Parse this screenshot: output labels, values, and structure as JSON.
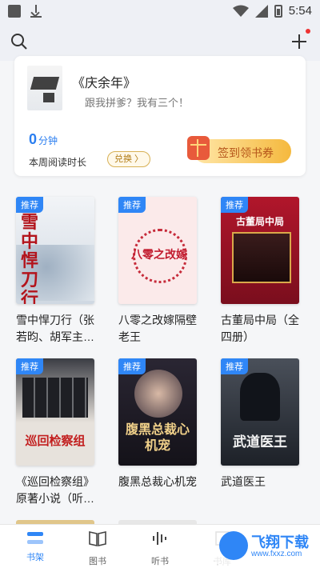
{
  "status": {
    "time": "5:54"
  },
  "header": {
    "search_icon": "search-icon",
    "add_icon": "plus-icon"
  },
  "current_book": {
    "title": "《庆余年》",
    "subtitle": "跟我拼爹？我有三个！",
    "minutes": "0",
    "minutes_unit": "分钟",
    "week_label": "本周阅读时长",
    "exchange_label": "兑换 〉",
    "signin_label": "签到领书券"
  },
  "badge_label": "推荐",
  "books": [
    {
      "title": "雪中悍刀行（张若昀、胡军主…",
      "cover_text": "雪中悍刀行",
      "cover_bg": "#e9edf2"
    },
    {
      "title": "八零之改嫁隔壁老王",
      "cover_text": "八零之改嫁",
      "cover_bg": "#fbe8e8"
    },
    {
      "title": "古董局中局（全四册）",
      "cover_text": "古董局中局",
      "cover_bg": "#a8182a"
    },
    {
      "title": "《巡回检察组》原著小说（听…",
      "cover_text": "巡回检察组",
      "cover_bg": "#e7e2dc"
    },
    {
      "title": "腹黑总裁心机宠",
      "cover_text": "腹黑总裁心机宠",
      "cover_bg": "#1f1d2b"
    },
    {
      "title": "武道医王",
      "cover_text": "武道医王",
      "cover_bg": "#2a2f38"
    }
  ],
  "tabs": [
    {
      "label": "书架",
      "icon": "bookshelf-icon",
      "active": true
    },
    {
      "label": "图书",
      "icon": "book-icon",
      "active": false
    },
    {
      "label": "听书",
      "icon": "audio-icon",
      "active": false
    },
    {
      "label": "书库",
      "icon": "library-icon",
      "active": false
    }
  ],
  "watermark": {
    "brand": "飞翔下载",
    "url": "www.fxxz.com"
  },
  "colors": {
    "accent": "#2f86f6",
    "signin_orange": "#f5b93e"
  }
}
